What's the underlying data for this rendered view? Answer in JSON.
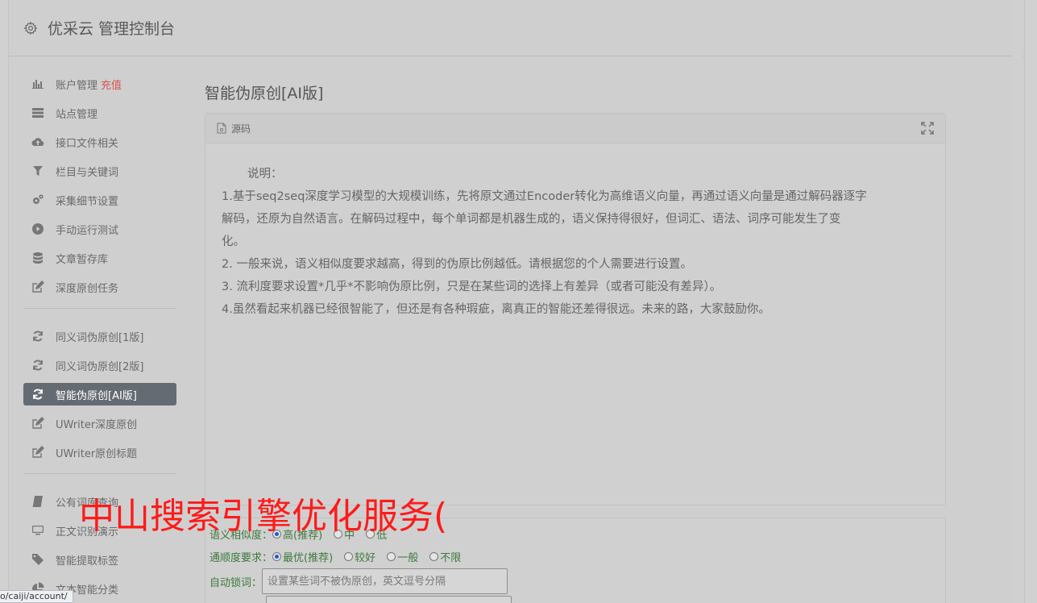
{
  "header": {
    "title": "优采云 管理控制台"
  },
  "sidebar": {
    "group1": [
      {
        "label": "账户管理",
        "extra": "充值",
        "icon": "bar-chart-icon"
      },
      {
        "label": "站点管理",
        "icon": "list-icon"
      },
      {
        "label": "接口文件相关",
        "icon": "cloud-upload-icon"
      },
      {
        "label": "栏目与关键词",
        "icon": "filter-icon"
      },
      {
        "label": "采集细节设置",
        "icon": "gears-icon"
      },
      {
        "label": "手动运行测试",
        "icon": "play-circle-icon"
      },
      {
        "label": "文章暂存库",
        "icon": "database-icon"
      },
      {
        "label": "深度原创任务",
        "icon": "edit-icon"
      }
    ],
    "group2": [
      {
        "label": "同义词伪原创[1版]",
        "icon": "refresh-icon"
      },
      {
        "label": "同义词伪原创[2版]",
        "icon": "refresh-icon"
      },
      {
        "label": "智能伪原创[AI版]",
        "icon": "refresh-icon",
        "active": true
      },
      {
        "label": "UWriter深度原创",
        "icon": "edit-icon"
      },
      {
        "label": "UWriter原创标题",
        "icon": "edit-icon"
      }
    ],
    "group3": [
      {
        "label": "公有词库查询",
        "icon": "book-icon"
      },
      {
        "label": "正文识别演示",
        "icon": "monitor-icon"
      },
      {
        "label": "智能提取标签",
        "icon": "tag-icon"
      },
      {
        "label": "文本智能分类",
        "icon": "pie-chart-icon"
      }
    ]
  },
  "main": {
    "page_title": "智能伪原创[AI版]",
    "panel": {
      "header": "源码",
      "intro": "说明：",
      "lines": [
        "1.基于seq2seq深度学习模型的大规模训练，先将原文通过Encoder转化为高维语义向量，再通过语义向量是通过解码器逐字",
        "解码，还原为自然语言。在解码过程中，每个单词都是机器生成的，语义保持得很好，但词汇、语法、词序可能发生了变",
        "化。",
        "2. 一般来说，语义相似度要求越高，得到的伪原比例越低。请根据您的个人需要进行设置。",
        "3. 流利度要求设置*几乎*不影响伪原比例，只是在某些词的选择上有差异（或者可能没有差异）。",
        "4.虽然看起来机器已经很智能了，但还是有各种瑕疵，离真正的智能还差得很远。未来的路，大家鼓励你。"
      ]
    },
    "settings": {
      "similarity": {
        "label": "语义相似度：",
        "options": [
          "高(推荐)",
          "中",
          "低"
        ],
        "selected": 0
      },
      "fluency": {
        "label": "通顺度要求：",
        "options": [
          "最优(推荐)",
          "较好",
          "一般",
          "不限"
        ],
        "selected": 0
      },
      "lock": {
        "label": "自动锁词：",
        "placeholder": "设置某些词不被伪原创，英文逗号分隔"
      }
    }
  },
  "overlay_text": "中山搜索引擎优化服务(",
  "status_url": "o/caiji/account/"
}
